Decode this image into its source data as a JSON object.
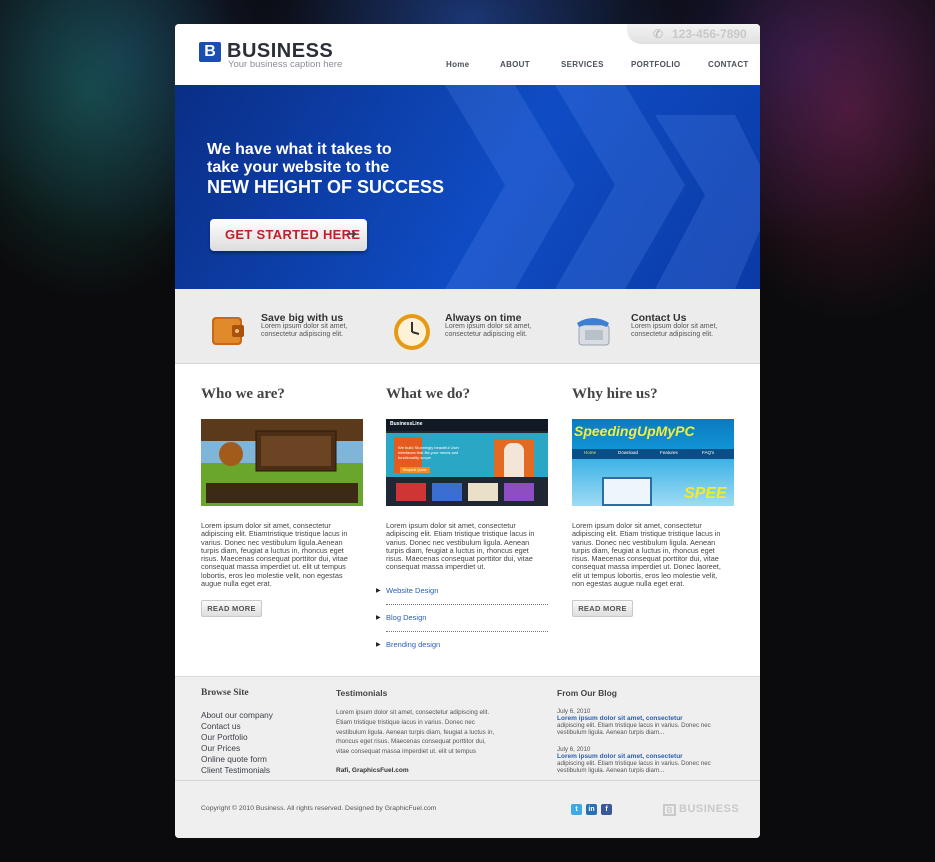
{
  "header": {
    "logo_mark": "B",
    "logo_text": "BUSINESS",
    "caption": "Your business caption here",
    "phone": "123-456-7890",
    "nav": [
      "Home",
      "ABOUT",
      "SERVICES",
      "PORTFOLIO",
      "CONTACT"
    ]
  },
  "hero": {
    "line1": "We have what it takes to",
    "line2": "take your website to the",
    "line3": "NEW HEIGHT OF SUCCESS",
    "cta": "GET STARTED HERE",
    "cta_arrow": "➔"
  },
  "features": [
    {
      "title": "Save big with us",
      "text": "Lorem ipsum dolor sit amet, consectetur adipiscing elit.",
      "icon": "wallet-icon"
    },
    {
      "title": "Always on time",
      "text": "Lorem ipsum dolor sit amet, consectetur adipiscing elit.",
      "icon": "clock-icon"
    },
    {
      "title": "Contact Us",
      "text": "Lorem ipsum dolor sit amet, consectetur adipiscing elit.",
      "icon": "telephone-icon"
    }
  ],
  "columns": {
    "who": {
      "title": "Who we are?",
      "text": "Lorem ipsum dolor sit amet, consectetur adipiscing elit. Etiamtristique tristique lacus in varius. Donec nec vestibulum ligula.Aenean turpis diam, feugiat a luctus in, rhoncus eget risus. Maecenas consequat porttitor dui, vitae consequat massa imperdiet ut. elit ut tempus lobortis, eros leo molestie velit, non egestas augue nulla eget erat.",
      "read_more": "READ MORE"
    },
    "what": {
      "title": "What we do?",
      "text": "Lorem ipsum dolor sit amet, consectetur adipiscing elit. Etiam tristique tristique lacus in varius. Donec nec vestibulum ligula. Aenean turpis diam, feugiat a luctus in, rhoncus eget risus. Maecenas consequat porttitor dui, vitae consequat massa imperdiet ut.",
      "thumb_brand": "BusinessLine",
      "thumb_headline": "We build Stunningly beautiful User Interfaces that fits your needs and functionality scope",
      "thumb_button": "Request Quote",
      "services": [
        "Website Design",
        "Blog Design",
        "Brending design"
      ]
    },
    "why": {
      "title": "Why hire us?",
      "text": "Lorem ipsum dolor sit amet, consectetur adipiscing elit. Etiam tristique tristique lacus in varius. Donec nec vestibulum ligula. Aenean turpis diam, feugiat a luctus in, rhoncus eget risus. Maecenas consequat porttitor dui, vitae consequat massa imperdiet ut. Donec laoreet, elit ut tempus lobortis, eros leo molestie velit, non egestas augue nulla eget erat.",
      "read_more": "READ MORE",
      "thumb_brand": "SpeedingUpMyPC",
      "thumb_nav": [
        "Home",
        "Download",
        "Features",
        "FAQ's"
      ],
      "thumb_tag": "SPEE"
    }
  },
  "footer": {
    "browse_title": "Browse Site",
    "browse_links": [
      "About our company",
      "Contact us",
      "Our Portfolio",
      "Our Prices",
      "Online quote form",
      "Client Testimonials"
    ],
    "testimonials_title": "Testimonials",
    "testimonial_text": "Lorem ipsum dolor sit amet, consectetur adipiscing elit. Etiam tristique tristique lacus in varius. Donec nec vestibulum ligula. Aenean turpis diam, feugiat a luctus in, rhoncus eget risus. Maecenas consequat porttitor dui, vitae consequat massa imperdiet ut. elit ut tempus",
    "testimonial_author": "Rafi, GraphicsFuel.com",
    "blog_title": "From Our Blog",
    "blog_posts": [
      {
        "date": "July 6, 2010",
        "title": "Lorem ipsum dolor sit amet, consectetur",
        "excerpt": "adipiscing elit. Etiam tristique lacus in varius. Donec nec vestibulum ligula. Aenean turpis diam..."
      },
      {
        "date": "July 6, 2010",
        "title": "Lorem ipsum dolor sit amet, consectetur",
        "excerpt": "adipiscing elit. Etiam tristique lacus in varius. Donec nec vestibulum ligula. Aenean turpis diam..."
      }
    ],
    "copyright": "Copyright © 2010 Business. All rights reserved. Designed by GraphicFuel.com",
    "social": [
      "t",
      "in",
      "f"
    ],
    "logo_mark": "B",
    "logo_text": "BUSINESS"
  },
  "colors": {
    "brand_blue": "#1a4fb0",
    "cta_red": "#c0202a",
    "link_blue": "#2b5fb0"
  }
}
